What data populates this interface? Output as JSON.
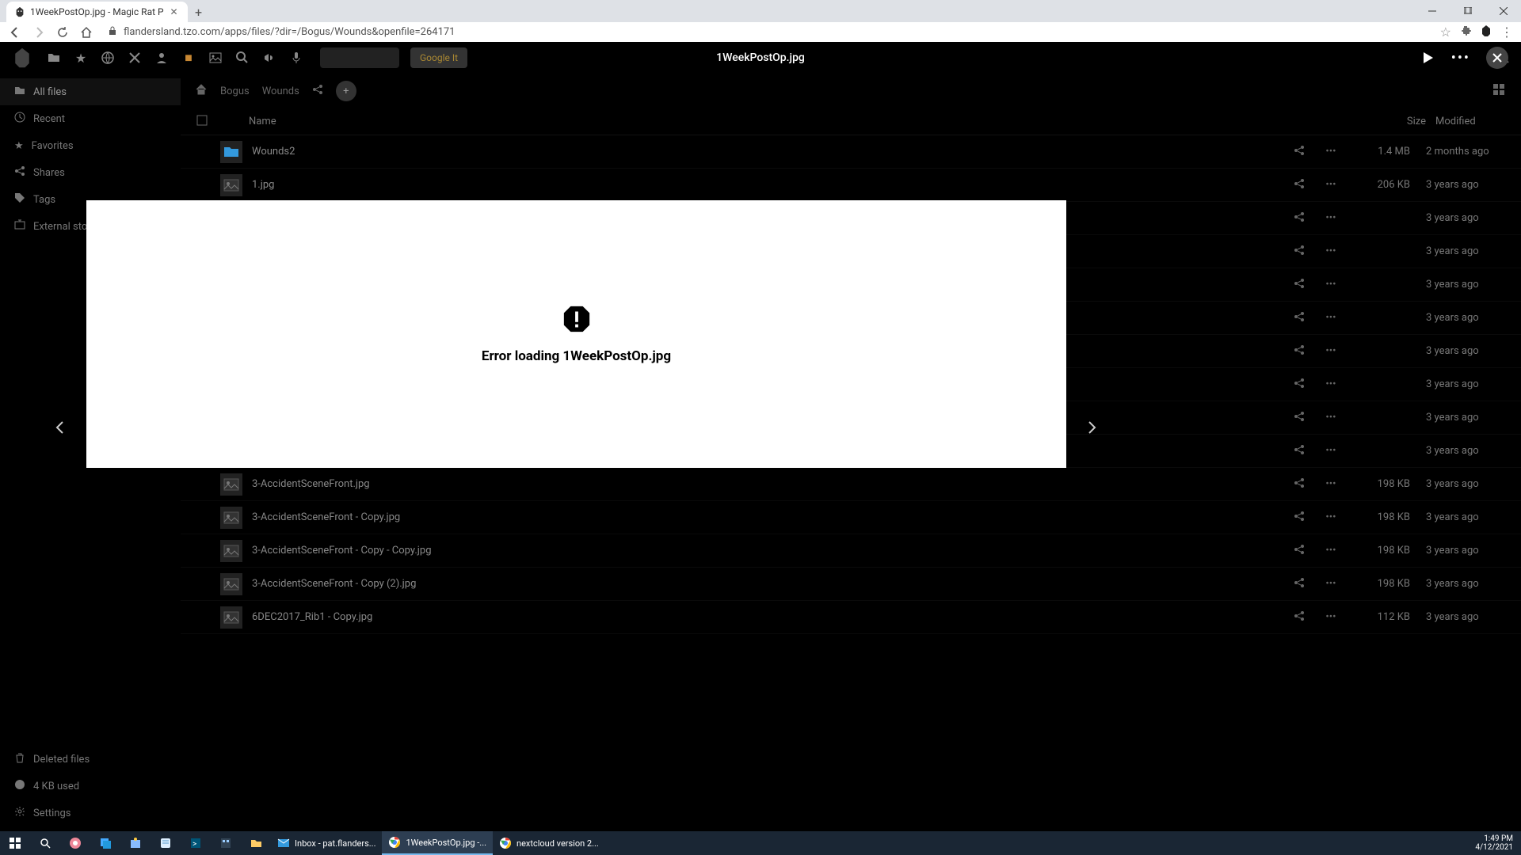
{
  "browser": {
    "tab_title": "1WeekPostOp.jpg - Magic Rat P",
    "url": "flandersland.tzo.com/apps/files/?dir=/Bogus/Wounds&openfile=264171"
  },
  "app_bar": {
    "google_btn": "Google It"
  },
  "viewer": {
    "title": "1WeekPostOp.jpg",
    "error": "Error loading 1WeekPostOp.jpg"
  },
  "sidebar": {
    "items": [
      {
        "label": "All files",
        "icon": "folder"
      },
      {
        "label": "Recent",
        "icon": "clock"
      },
      {
        "label": "Favorites",
        "icon": "star"
      },
      {
        "label": "Shares",
        "icon": "share"
      },
      {
        "label": "Tags",
        "icon": "tag"
      },
      {
        "label": "External stora",
        "icon": "external"
      }
    ],
    "bottom": [
      {
        "label": "Deleted files",
        "icon": "trash"
      },
      {
        "label": "4 KB used",
        "icon": "gauge"
      },
      {
        "label": "Settings",
        "icon": "gear"
      }
    ]
  },
  "breadcrumb": [
    "Bogus",
    "Wounds"
  ],
  "table": {
    "head_name": "Name",
    "head_size": "Size",
    "head_mod": "Modified"
  },
  "files": [
    {
      "name": "Wounds2",
      "size": "1.4 MB",
      "modified": "2 months ago"
    },
    {
      "name": "1.jpg",
      "size": "206 KB",
      "modified": "3 years ago"
    },
    {
      "name": "",
      "size": "",
      "modified": "3 years ago"
    },
    {
      "name": "",
      "size": "",
      "modified": "3 years ago"
    },
    {
      "name": "",
      "size": "",
      "modified": "3 years ago"
    },
    {
      "name": "",
      "size": "",
      "modified": "3 years ago"
    },
    {
      "name": "",
      "size": "",
      "modified": "3 years ago"
    },
    {
      "name": "",
      "size": "",
      "modified": "3 years ago"
    },
    {
      "name": "",
      "size": "",
      "modified": "3 years ago"
    },
    {
      "name": "",
      "size": "",
      "modified": "3 years ago"
    },
    {
      "name": "3-AccidentSceneFront.jpg",
      "size": "198 KB",
      "modified": "3 years ago"
    },
    {
      "name": "3-AccidentSceneFront - Copy.jpg",
      "size": "198 KB",
      "modified": "3 years ago"
    },
    {
      "name": "3-AccidentSceneFront - Copy - Copy.jpg",
      "size": "198 KB",
      "modified": "3 years ago"
    },
    {
      "name": "3-AccidentSceneFront - Copy (2).jpg",
      "size": "198 KB",
      "modified": "3 years ago"
    },
    {
      "name": "6DEC2017_Rib1 - Copy.jpg",
      "size": "112 KB",
      "modified": "3 years ago"
    }
  ],
  "taskbar": {
    "apps": [
      {
        "label": "Inbox - pat.flanders...",
        "icon": "mail"
      },
      {
        "label": "1WeekPostOp.jpg -...",
        "icon": "chrome",
        "active": true
      },
      {
        "label": "nextcloud version 2...",
        "icon": "chrome"
      }
    ],
    "time": "1:49 PM",
    "date": "4/12/2021"
  }
}
